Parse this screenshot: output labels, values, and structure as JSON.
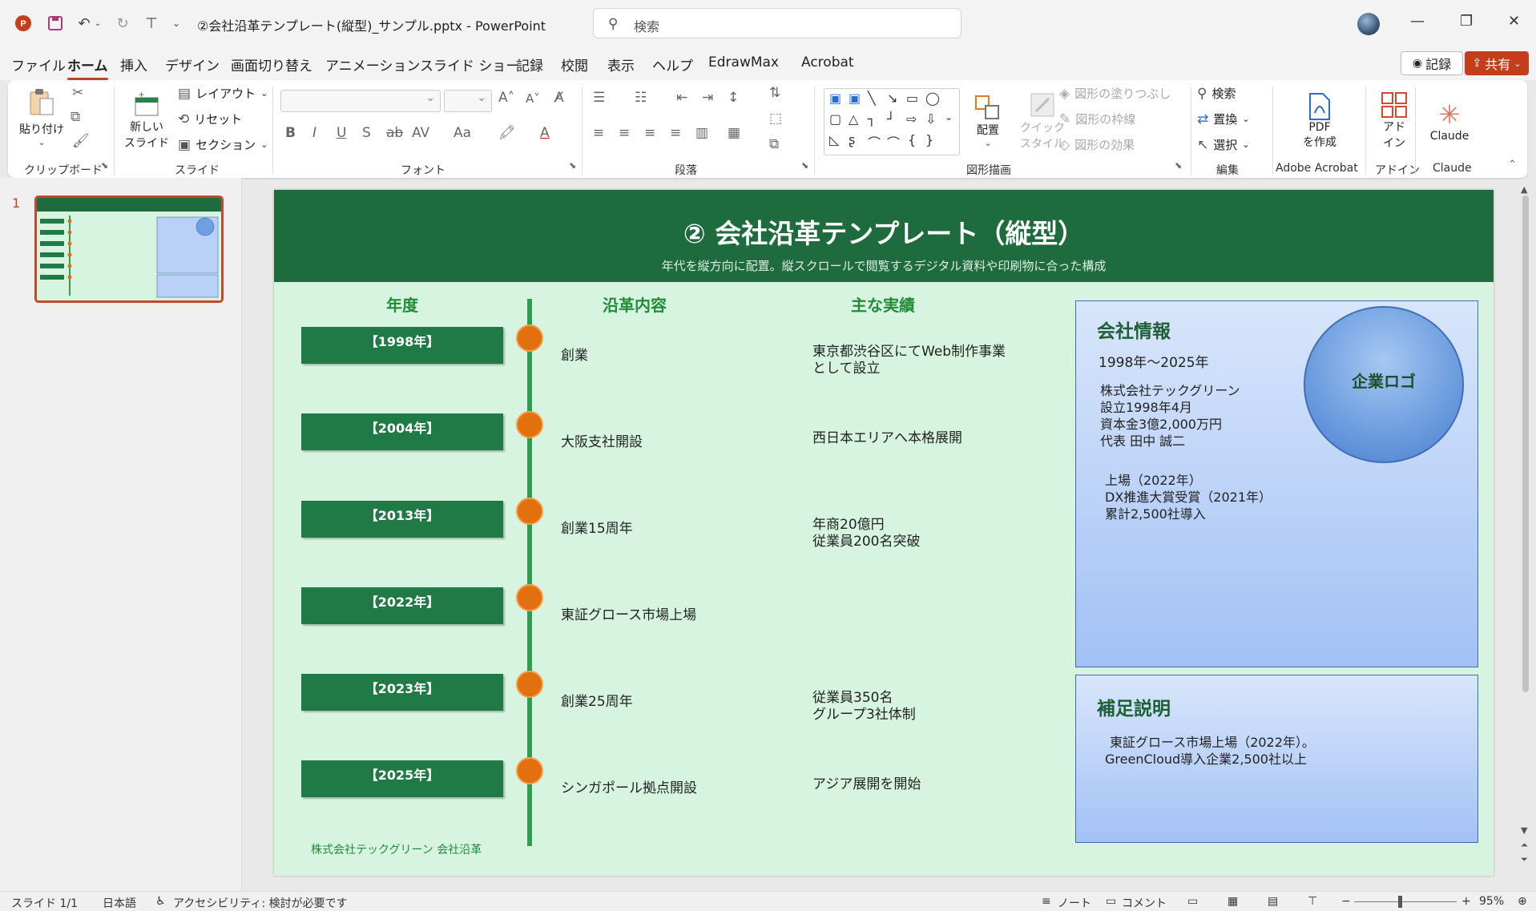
{
  "titlebar": {
    "document_title": "②会社沿革テンプレート(縦型)_サンプル.pptx  -  PowerPoint",
    "search_placeholder": "検索"
  },
  "menu": {
    "items": [
      "ファイル",
      "ホーム",
      "挿入",
      "デザイン",
      "画面切り替え",
      "アニメーション",
      "スライド ショー",
      "記録",
      "校閲",
      "表示",
      "ヘルプ",
      "EdrawMax",
      "Acrobat"
    ],
    "active": "ホーム",
    "record_label": "記録",
    "share_label": "共有"
  },
  "ribbon": {
    "clipboard": {
      "paste": "貼り付け",
      "group": "クリップボード"
    },
    "slides": {
      "new_slide_line1": "新しい",
      "new_slide_line2": "スライド",
      "layout": "レイアウト",
      "reset": "リセット",
      "section": "セクション",
      "group": "スライド"
    },
    "font": {
      "group": "フォント"
    },
    "paragraph": {
      "group": "段落"
    },
    "drawing": {
      "arrange": "配置",
      "quick_style_line1": "クイック",
      "quick_style_line2": "スタイル",
      "fill": "図形の塗りつぶし",
      "outline": "図形の枠線",
      "effects": "図形の効果",
      "group": "図形描画"
    },
    "editing": {
      "find": "検索",
      "replace": "置換",
      "select": "選択",
      "group": "編集"
    },
    "acrobat": {
      "pdf_line1": "PDF",
      "pdf_line2": "を作成",
      "group": "Adobe Acrobat"
    },
    "addins": {
      "label_line1": "アド",
      "label_line2": "イン",
      "group": "アドイン"
    },
    "claude": {
      "label": "Claude",
      "group": "Claude"
    }
  },
  "thumbnail": {
    "slide_number": "1"
  },
  "slide": {
    "title": "② 会社沿革テンプレート（縦型）",
    "subtitle": "年代を縦方向に配置。縦スクロールで閲覧するデジタル資料や印刷物に合った構成",
    "columns": {
      "year": "年度",
      "history": "沿革内容",
      "achievements": "主な実績"
    },
    "timeline": [
      {
        "year": "【1998年】",
        "event": "創業",
        "achv1": "東京都渋谷区にてWeb制作事業",
        "achv2": "として設立"
      },
      {
        "year": "【2004年】",
        "event": "大阪支社開設",
        "achv1": "西日本エリアへ本格展開",
        "achv2": ""
      },
      {
        "year": "【2013年】",
        "event": "創業15周年",
        "achv1": "年商20億円",
        "achv2": "従業員200名突破"
      },
      {
        "year": "【2022年】",
        "event": "東証グロース市場上場",
        "achv1": "",
        "achv2": ""
      },
      {
        "year": "【2023年】",
        "event": "創業25周年",
        "achv1": "従業員350名",
        "achv2": "グループ3社体制"
      },
      {
        "year": "【2025年】",
        "event": "シンガポール拠点開設",
        "achv1": "アジア展開を開始",
        "achv2": ""
      }
    ],
    "info": {
      "title": "会社情報",
      "period": "1998年〜2025年",
      "lines": [
        "株式会社テックグリーン",
        "設立1998年4月",
        "資本金3億2,000万円",
        "代表 田中 誠二"
      ],
      "highlights": [
        "上場（2022年）",
        "DX推進大賞受賞（2021年）",
        "累計2,500社導入"
      ],
      "logo": "企業ロゴ"
    },
    "note": {
      "title": "補足説明",
      "lines": [
        "東証グロース市場上場（2022年）。",
        "GreenCloud導入企業2,500社以上"
      ]
    },
    "footer": "株式会社テックグリーン 会社沿革"
  },
  "statusbar": {
    "slide_info": "スライド 1/1",
    "language": "日本語",
    "accessibility": "アクセシビリティ: 検討が必要です",
    "notes": "ノート",
    "comments": "コメント",
    "zoom": "95%"
  },
  "colors": {
    "header_green": "#1e6b3e",
    "slide_bg": "#d7f4e0",
    "year_box": "#1f7a46",
    "timeline_dot": "#e3700f",
    "accent_red": "#c43e1c"
  }
}
